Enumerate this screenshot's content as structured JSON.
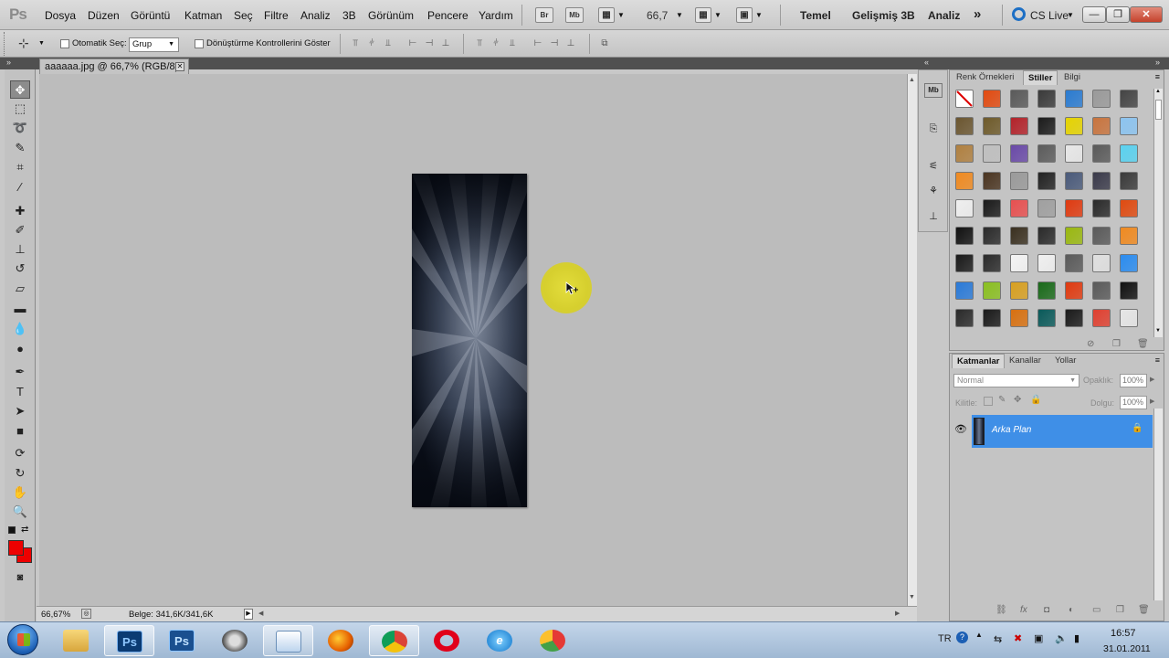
{
  "app": {
    "logo": "Ps"
  },
  "menu": [
    "Dosya",
    "Düzen",
    "Görüntü",
    "Katman",
    "Seç",
    "Filtre",
    "Analiz",
    "3B",
    "Görünüm",
    "Pencere",
    "Yardım"
  ],
  "menubar_buttons": {
    "bridge": "Br",
    "minibridge": "Mb",
    "zoom": "66,7"
  },
  "workspaces": [
    "Temel",
    "Gelişmiş 3B",
    "Analiz"
  ],
  "workspace_more": "»",
  "cs_live": "CS Live",
  "window_controls": {
    "minimize": "—",
    "restore": "❐",
    "close": "✕"
  },
  "options": {
    "auto_select_label": "Otomatik Seç:",
    "auto_select_value": "Grup",
    "transform_label": "Dönüştürme Kontrollerini Göster"
  },
  "document": {
    "tab_title": "aaaaaa.jpg @ 66,7% (RGB/8)",
    "close": "✕"
  },
  "status": {
    "zoom": "66,67%",
    "doc_info": "Belge: 341,6K/341,6K"
  },
  "styles_panel": {
    "tabs": [
      "Renk Örnekleri",
      "Stiller",
      "Bilgi"
    ],
    "active_tab": "Stiller"
  },
  "layers_panel": {
    "tabs": [
      "Katmanlar",
      "Kanallar",
      "Yollar"
    ],
    "active_tab": "Katmanlar",
    "blend_mode": "Normal",
    "opacity_label": "Opaklık:",
    "opacity_value": "100%",
    "lock_label": "Kilitle:",
    "fill_label": "Dolgu:",
    "fill_value": "100%",
    "layers": [
      {
        "name": "Arka Plan",
        "visible": true,
        "locked": true
      }
    ]
  },
  "colors": {
    "foreground": "#ee0000",
    "background": "#ee0000",
    "selected_layer": "#3f8fe7",
    "cursor_highlight": "#dcd634"
  },
  "taskbar": {
    "apps": [
      "start-orb",
      "explorer",
      "photoshop",
      "photoshop",
      "app-swirl",
      "notepad",
      "firefox",
      "chrome",
      "opera",
      "internet-explorer",
      "app-picnic"
    ],
    "language": "TR",
    "time": "16:57",
    "date": "31.01.2011"
  }
}
